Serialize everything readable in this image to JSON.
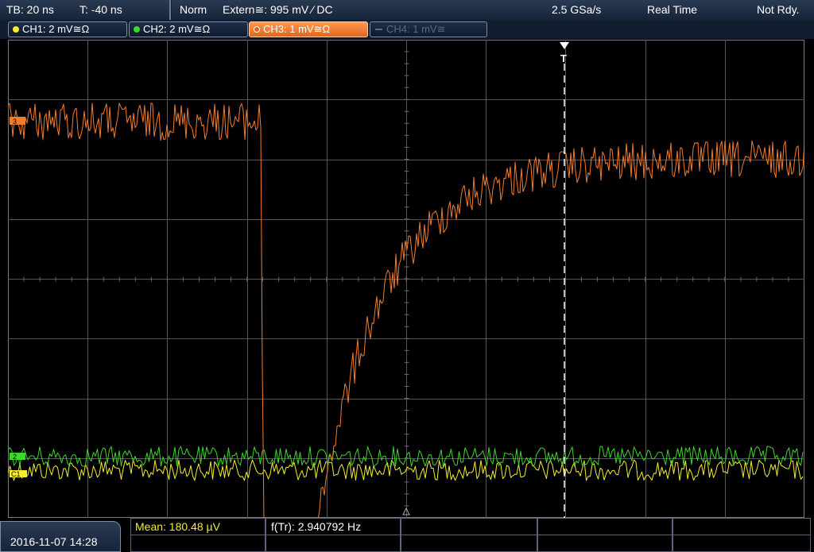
{
  "topbar": {
    "timebase": "TB: 20 ns",
    "trigger_time": "T: -40 ns",
    "mode": "Norm",
    "trigger_source": "Extern≅: 995 mV ⁄ DC",
    "sample_rate": "2.5 GSa/s",
    "acquisition": "Real Time",
    "status": "Not Rdy."
  },
  "channels": [
    {
      "label": "CH1: 2 mV≅Ω",
      "color": "#f4ee2c",
      "active": true
    },
    {
      "label": "CH2: 2 mV≅Ω",
      "color": "#3cd82a",
      "active": true
    },
    {
      "label": "CH3: 1 mV≅Ω",
      "color": "#f47d2a",
      "active": true,
      "selected": true
    },
    {
      "label": "CH4: 1 mV≅",
      "color": "#5b6a7e",
      "active": false
    }
  ],
  "markers": {
    "trigger_marker": "T",
    "ch3_marker": "3",
    "ch2_marker": "2",
    "ch1_marker": "C1"
  },
  "measurements": {
    "mean": "Mean: 180.48 µV",
    "frequency": "f(Tr): 2.940792 Hz"
  },
  "datetime": "2016-11-07 14:28",
  "colors": {
    "ch1": "#f4ee2c",
    "ch2": "#3cd82a",
    "ch3": "#f47d2a",
    "grid": "#555555",
    "background": "#000000"
  }
}
